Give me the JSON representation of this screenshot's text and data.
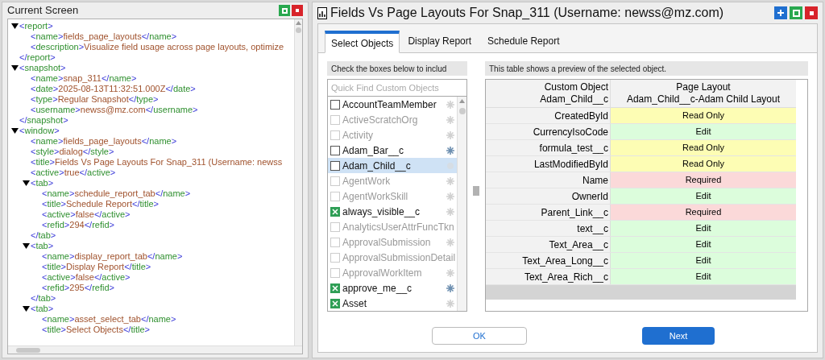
{
  "left_panel": {
    "title": "Current Screen",
    "tree": [
      {
        "tag": "<report>",
        "expanded": true,
        "close": "</report>",
        "children": [
          {
            "open": "<name>",
            "value": "fields_page_layouts",
            "close": "</name>"
          },
          {
            "open": "<description>",
            "value": "Visualize field usage across page layouts, optimize"
          }
        ]
      },
      {
        "tag": "<snapshot>",
        "expanded": true,
        "close": "</snapshot>",
        "children": [
          {
            "open": "<name>",
            "value": "snap_311",
            "close": "</name>"
          },
          {
            "open": "<date>",
            "value": "2025-08-13T11:32:51.000Z",
            "close": "</date>"
          },
          {
            "open": "<type>",
            "value": "Regular Snapshot",
            "close": "</type>"
          },
          {
            "open": "<username>",
            "value": "newss@mz.com",
            "close": "</username>"
          }
        ]
      },
      {
        "tag": "<window>",
        "expanded": true,
        "children": [
          {
            "open": "<name>",
            "value": "fields_page_layouts",
            "close": "</name>"
          },
          {
            "open": "<style>",
            "value": "dialog",
            "close": "</style>"
          },
          {
            "open": "<title>",
            "value": "Fields Vs Page Layouts For Snap_311 (Username: newss"
          },
          {
            "open": "<active>",
            "value": "true",
            "close": "</active>"
          },
          {
            "tag": "<tab>",
            "expanded": true,
            "close": "</tab>",
            "children": [
              {
                "open": "<name>",
                "value": "schedule_report_tab",
                "close": "</name>"
              },
              {
                "open": "<title>",
                "value": "Schedule Report",
                "close": "</title>"
              },
              {
                "open": "<active>",
                "value": "false",
                "close": "</active>"
              },
              {
                "open": "<refid>",
                "value": "294",
                "close": "</refid>"
              }
            ]
          },
          {
            "tag": "<tab>",
            "expanded": true,
            "close": "</tab>",
            "children": [
              {
                "open": "<name>",
                "value": "display_report_tab",
                "close": "</name>"
              },
              {
                "open": "<title>",
                "value": "Display Report",
                "close": "</title>"
              },
              {
                "open": "<active>",
                "value": "false",
                "close": "</active>"
              },
              {
                "open": "<refid>",
                "value": "295",
                "close": "</refid>"
              }
            ]
          },
          {
            "tag": "<tab>",
            "expanded": true,
            "children": [
              {
                "open": "<name>",
                "value": "asset_select_tab",
                "close": "</name>"
              },
              {
                "open": "<title>",
                "value": "Select Objects",
                "close": "</title>"
              }
            ]
          }
        ]
      }
    ]
  },
  "dialog": {
    "title": "Fields Vs Page Layouts For Snap_311 (Username: newss@mz.com)",
    "tabs": [
      {
        "label": "Select Objects",
        "selected": true
      },
      {
        "label": "Display Report",
        "selected": false
      },
      {
        "label": "Schedule Report",
        "selected": false
      }
    ],
    "objects": {
      "header": "Check the boxes below to includ",
      "search": {
        "placeholder": "Quick Find Custom Objects"
      },
      "items": [
        {
          "name": "AccountTeamMember",
          "enabled": true,
          "checked": false,
          "selected": false,
          "kind": "asterisk",
          "color": "#d0d0d0"
        },
        {
          "name": "ActiveScratchOrg",
          "enabled": false,
          "checked": false,
          "selected": false,
          "kind": "asterisk",
          "color": "#d0d0d0"
        },
        {
          "name": "Activity",
          "enabled": false,
          "checked": false,
          "selected": false,
          "kind": "asterisk",
          "color": "#d0d0d0"
        },
        {
          "name": "Adam_Bar__c",
          "enabled": true,
          "checked": false,
          "selected": false,
          "kind": "asterisk",
          "color": "#6d8fb0"
        },
        {
          "name": "Adam_Child__c",
          "enabled": true,
          "checked": false,
          "selected": true,
          "kind": "dot",
          "color": "#d6dde4"
        },
        {
          "name": "AgentWork",
          "enabled": false,
          "checked": false,
          "selected": false,
          "kind": "asterisk",
          "color": "#d0d0d0"
        },
        {
          "name": "AgentWorkSkill",
          "enabled": false,
          "checked": false,
          "selected": false,
          "kind": "asterisk",
          "color": "#d0d0d0"
        },
        {
          "name": "always_visible__c",
          "enabled": true,
          "checked": true,
          "selected": false,
          "kind": "asterisk",
          "color": "#d0d0d0"
        },
        {
          "name": "AnalyticsUserAttrFuncTkn",
          "enabled": false,
          "checked": false,
          "selected": false
        },
        {
          "name": "ApprovalSubmission",
          "enabled": false,
          "checked": false,
          "selected": false,
          "kind": "asterisk",
          "color": "#d0d0d0"
        },
        {
          "name": "ApprovalSubmissionDetail",
          "enabled": false,
          "checked": false,
          "selected": false
        },
        {
          "name": "ApprovalWorkItem",
          "enabled": false,
          "checked": false,
          "selected": false,
          "kind": "asterisk",
          "color": "#d0d0d0"
        },
        {
          "name": "approve_me__c",
          "enabled": true,
          "checked": true,
          "selected": false,
          "kind": "asterisk",
          "color": "#6d8fb0"
        },
        {
          "name": "Asset",
          "enabled": true,
          "checked": true,
          "selected": false,
          "kind": "asterisk",
          "color": "#d0d0d0"
        }
      ]
    },
    "preview": {
      "header": "This table shows a preview of the selected object.",
      "columns": [
        [
          "Custom Object",
          "Adam_Child__c"
        ],
        [
          "Page Layout",
          "Adam_Child__c-Adam Child Layout"
        ]
      ],
      "rows": [
        {
          "field": "CreatedById",
          "access": "Read Only",
          "kind": "readonly"
        },
        {
          "field": "CurrencyIsoCode",
          "access": "Edit",
          "kind": "edit"
        },
        {
          "field": "formula_test__c",
          "access": "Read Only",
          "kind": "readonly"
        },
        {
          "field": "LastModifiedById",
          "access": "Read Only",
          "kind": "readonly"
        },
        {
          "field": "Name",
          "access": "Required",
          "kind": "required"
        },
        {
          "field": "OwnerId",
          "access": "Edit",
          "kind": "edit"
        },
        {
          "field": "Parent_Link__c",
          "access": "Required",
          "kind": "required"
        },
        {
          "field": "text__c",
          "access": "Edit",
          "kind": "edit"
        },
        {
          "field": "Text_Area__c",
          "access": "Edit",
          "kind": "edit"
        },
        {
          "field": "Text_Area_Long__c",
          "access": "Edit",
          "kind": "edit"
        },
        {
          "field": "Text_Area_Rich__c",
          "access": "Edit",
          "kind": "edit"
        }
      ]
    },
    "buttons": [
      {
        "label": "OK",
        "kind": "secondary"
      },
      {
        "label": "Next",
        "kind": "primary"
      }
    ]
  }
}
